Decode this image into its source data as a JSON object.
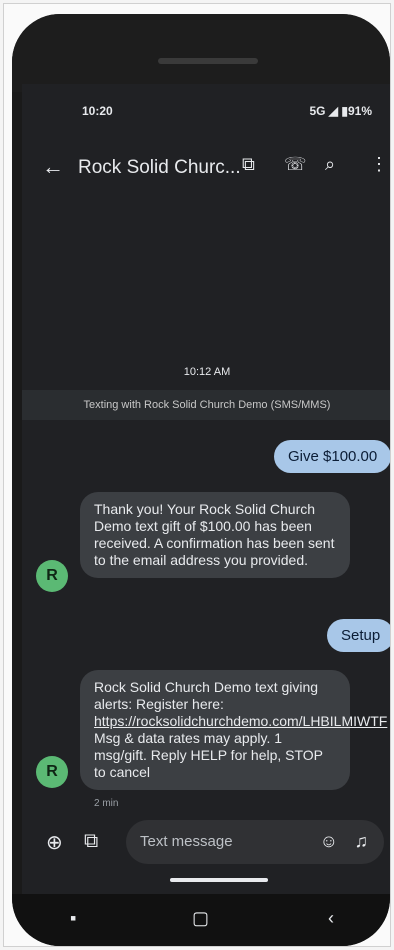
{
  "status": {
    "time": "10:20",
    "right": "5G ◢ ▮91%"
  },
  "appbar": {
    "back_icon": "arrow-left-icon",
    "title": "Rock Solid Churc...",
    "video_icon": "video-icon",
    "phone_icon": "phone-icon",
    "search_icon": "search-icon",
    "more_icon": "more-vert-icon"
  },
  "conversation": {
    "timestamp": "10:12 AM",
    "banner": "Texting with Rock Solid Church Demo (SMS/MMS)",
    "messages": [
      {
        "from": "me",
        "text": "Give $100.00"
      },
      {
        "from": "them",
        "avatar": "R",
        "text": "Thank you! Your Rock Solid Church Demo text gift of $100.00 has been received. A confirmation has been sent to the email address you provided."
      },
      {
        "from": "me",
        "text": "Setup"
      },
      {
        "from": "them",
        "avatar": "R",
        "text_before": "Rock Solid Church Demo text giving alerts: Register here:",
        "link": "https://rocksolidchurchdemo.com/LHBILMIWTF",
        "text_after": "Msg & data rates may apply. 1 msg/gift. Reply HELP for help, STOP to cancel",
        "meta": "2 min"
      }
    ]
  },
  "composer": {
    "placeholder": "Text message",
    "plus_icon": "add-circle-icon",
    "gallery_icon": "gallery-icon",
    "emoji_icon": "emoji-icon",
    "mic_icon": "mic-icon"
  },
  "navbar": {
    "back_icon": "nav-back-icon",
    "home_icon": "nav-home-icon",
    "recent_icon": "nav-recent-icon"
  }
}
